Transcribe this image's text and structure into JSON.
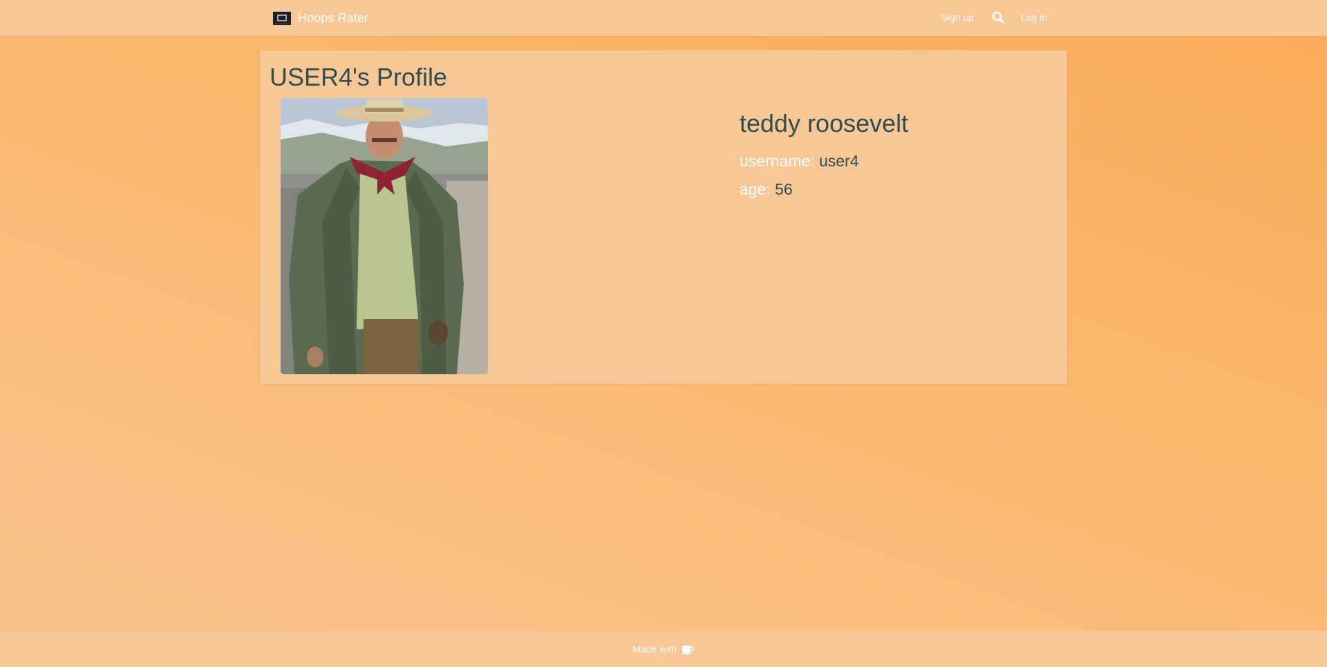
{
  "navbar": {
    "brand": "Hoops Rater",
    "brand_icon": "tv-icon",
    "signup_label": "Sign up",
    "search_icon": "search-icon",
    "login_label": "Log in"
  },
  "profile": {
    "title": "USER4's Profile",
    "photo_icon": "profile-photo",
    "full_name": "teddy roosevelt",
    "fields": [
      {
        "label": "username:",
        "value": "user4"
      },
      {
        "label": "age:",
        "value": "56"
      }
    ]
  },
  "footer": {
    "text": "Made with",
    "icon": "coffee-icon"
  },
  "colors": {
    "accent_text": "#2f4f4f",
    "panel": "#f7c795",
    "background": "#fbab58"
  }
}
